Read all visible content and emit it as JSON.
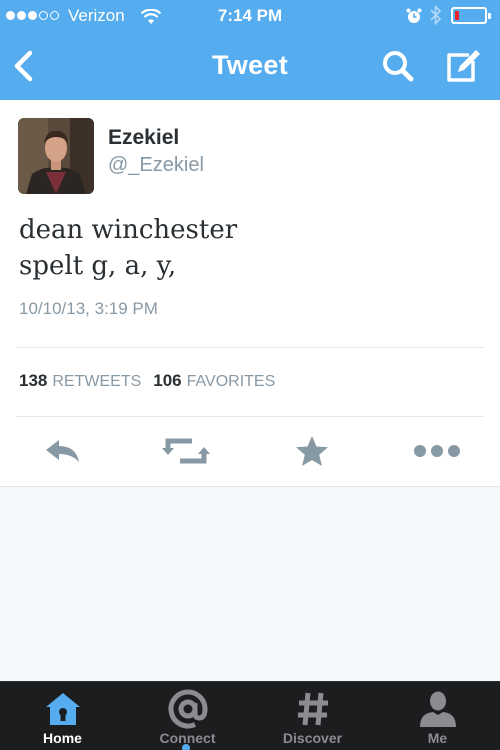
{
  "status_bar": {
    "carrier": "Verizon",
    "time": "7:14 PM",
    "signal_bars_filled": 3,
    "signal_bars_total": 5,
    "battery_level": 0.15,
    "icons": [
      "wifi-icon",
      "alarm-icon",
      "bluetooth-icon",
      "battery-icon"
    ]
  },
  "nav": {
    "title": "Tweet",
    "icons": [
      "back-arrow-icon",
      "search-icon",
      "compose-icon"
    ]
  },
  "tweet": {
    "author_name": "Ezekiel",
    "author_handle": "@_Ezekiel",
    "text_lines": [
      "dean winchester",
      "spelt g, a, y,"
    ],
    "timestamp": "10/10/13, 3:19 PM",
    "retweets_count": "138",
    "retweets_label": "RETWEETS",
    "favorites_count": "106",
    "favorites_label": "FAVORITES",
    "actions": [
      "reply-icon",
      "retweet-icon",
      "favorite-star-icon",
      "more-dots-icon"
    ]
  },
  "tabbar": {
    "tabs": [
      {
        "label": "Home",
        "icon": "home-icon",
        "active": true
      },
      {
        "label": "Connect",
        "icon": "at-sign-icon",
        "active": false
      },
      {
        "label": "Discover",
        "icon": "hashtag-icon",
        "active": false
      },
      {
        "label": "Me",
        "icon": "person-icon",
        "active": false
      }
    ]
  },
  "colors": {
    "brand_blue": "#55acee",
    "tabbar_bg": "#1c1d1f",
    "text_dark": "#292f33",
    "text_muted": "#8899a6",
    "action_gray": "#8899a6",
    "battery_low": "#e8262b"
  }
}
